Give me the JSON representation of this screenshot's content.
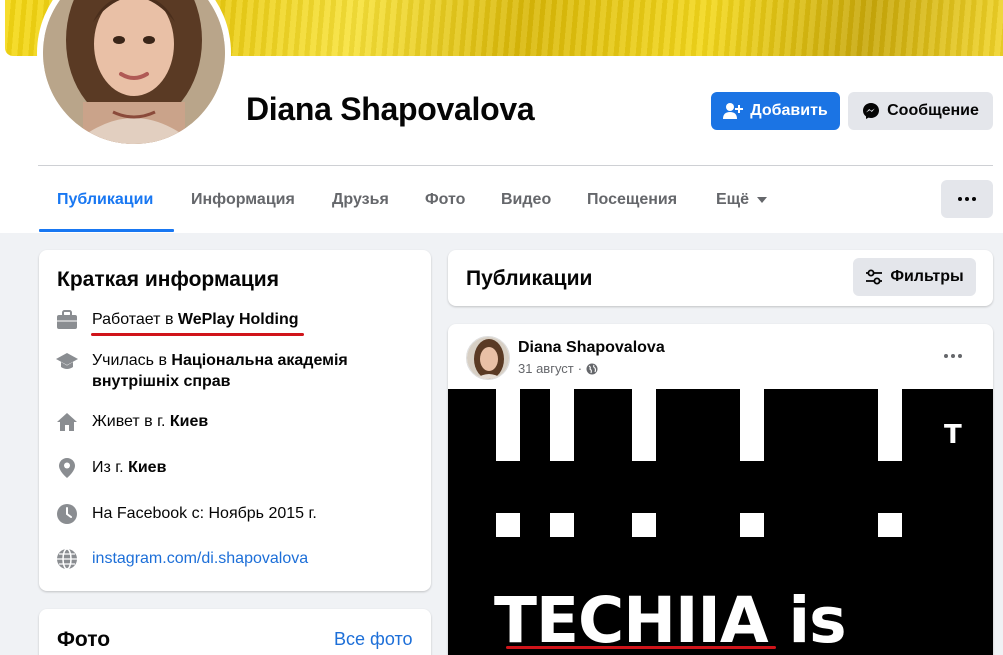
{
  "profile": {
    "name": "Diana Shapovalova",
    "add_button_label": "Добавить",
    "message_button_label": "Сообщение"
  },
  "tabs": [
    {
      "label": "Публикации",
      "active": true
    },
    {
      "label": "Информация"
    },
    {
      "label": "Друзья"
    },
    {
      "label": "Фото"
    },
    {
      "label": "Видео"
    },
    {
      "label": "Посещения"
    },
    {
      "label": "Ещё"
    }
  ],
  "intro": {
    "title": "Краткая информация",
    "work_prefix": "Работает в ",
    "work_place": "WePlay Holding",
    "study_prefix": "Училась в ",
    "study_place_line1": "Національна академія",
    "study_place_line2": "внутрішніх справ",
    "lives_prefix": "Живет в г. ",
    "lives_city": "Киев",
    "from_prefix": "Из г. ",
    "from_city": "Киев",
    "joined": "На Facebook с: Ноябрь 2015 г.",
    "website": "instagram.com/di.shapovalova"
  },
  "photos": {
    "title": "Фото",
    "all_link": "Все фото"
  },
  "posts": {
    "title": "Публикации",
    "filter_label": "Фильтры"
  },
  "post": {
    "author": "Diana Shapovalova",
    "date": "31 август",
    "image_letter": "T",
    "image_text": "TECHIIA is"
  },
  "colors": {
    "accent": "#1877f2",
    "button_primary": "#1b74e4",
    "highlight_underline": "#d0141a",
    "cover": "#f5d915"
  }
}
